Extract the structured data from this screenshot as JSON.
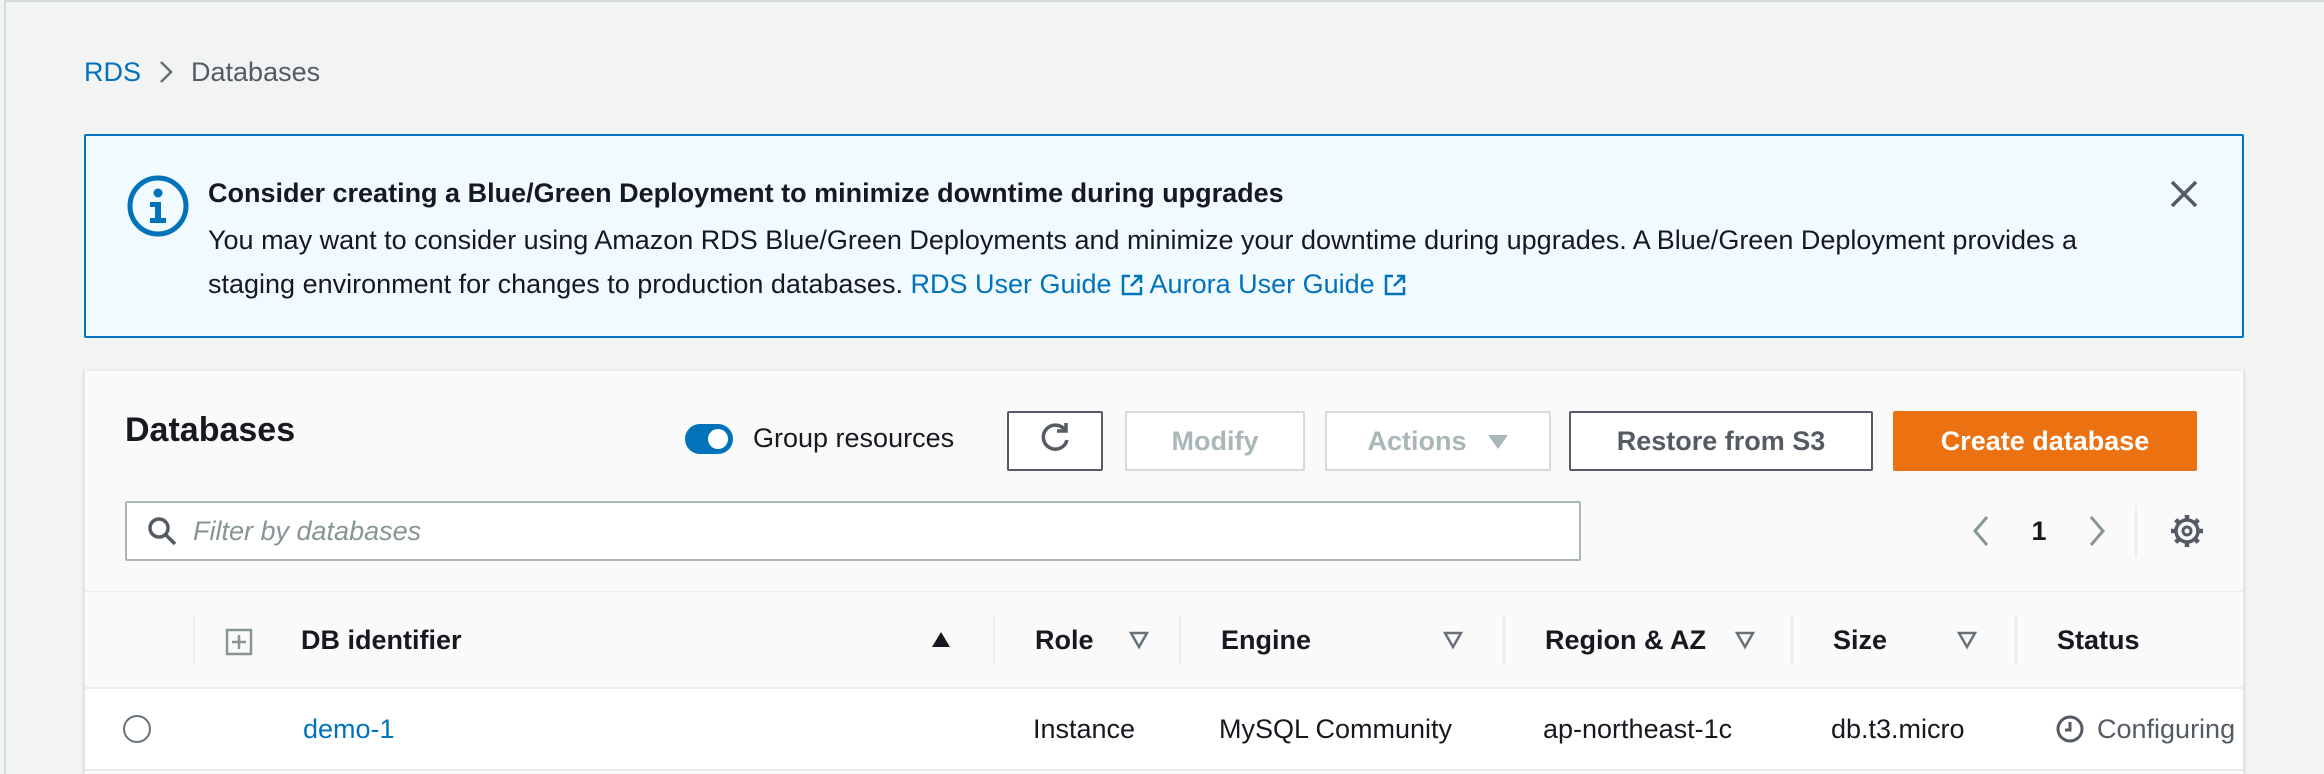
{
  "breadcrumb": {
    "root": "RDS",
    "current": "Databases"
  },
  "banner": {
    "title": "Consider creating a Blue/Green Deployment to minimize downtime during upgrades",
    "body": "You may want to consider using Amazon RDS Blue/Green Deployments and minimize your downtime during upgrades. A Blue/Green Deployment provides a staging environment for changes to production databases.",
    "link_rds": "RDS User Guide",
    "link_aurora": "Aurora User Guide",
    "info_icon": "info-icon",
    "close_icon": "close-icon"
  },
  "panel": {
    "title": "Databases",
    "group_resources_label": "Group resources",
    "group_resources_on": true,
    "modify_label": "Modify",
    "actions_label": "Actions",
    "restore_label": "Restore from S3",
    "create_label": "Create database",
    "filter_placeholder": "Filter by databases",
    "filter_value": "",
    "page": "1"
  },
  "table": {
    "columns": {
      "db_identifier": "DB identifier",
      "role": "Role",
      "engine": "Engine",
      "region": "Region & AZ",
      "size": "Size",
      "status": "Status"
    },
    "rows": [
      {
        "db_identifier": "demo-1",
        "role": "Instance",
        "engine": "MySQL Community",
        "region": "ap-northeast-1c",
        "size": "db.t3.micro",
        "status": "Configuring"
      }
    ]
  },
  "colors": {
    "link": "#0073bb",
    "primary": "#ec7211",
    "banner_bg": "#f1faff",
    "banner_border": "#0073bb"
  }
}
